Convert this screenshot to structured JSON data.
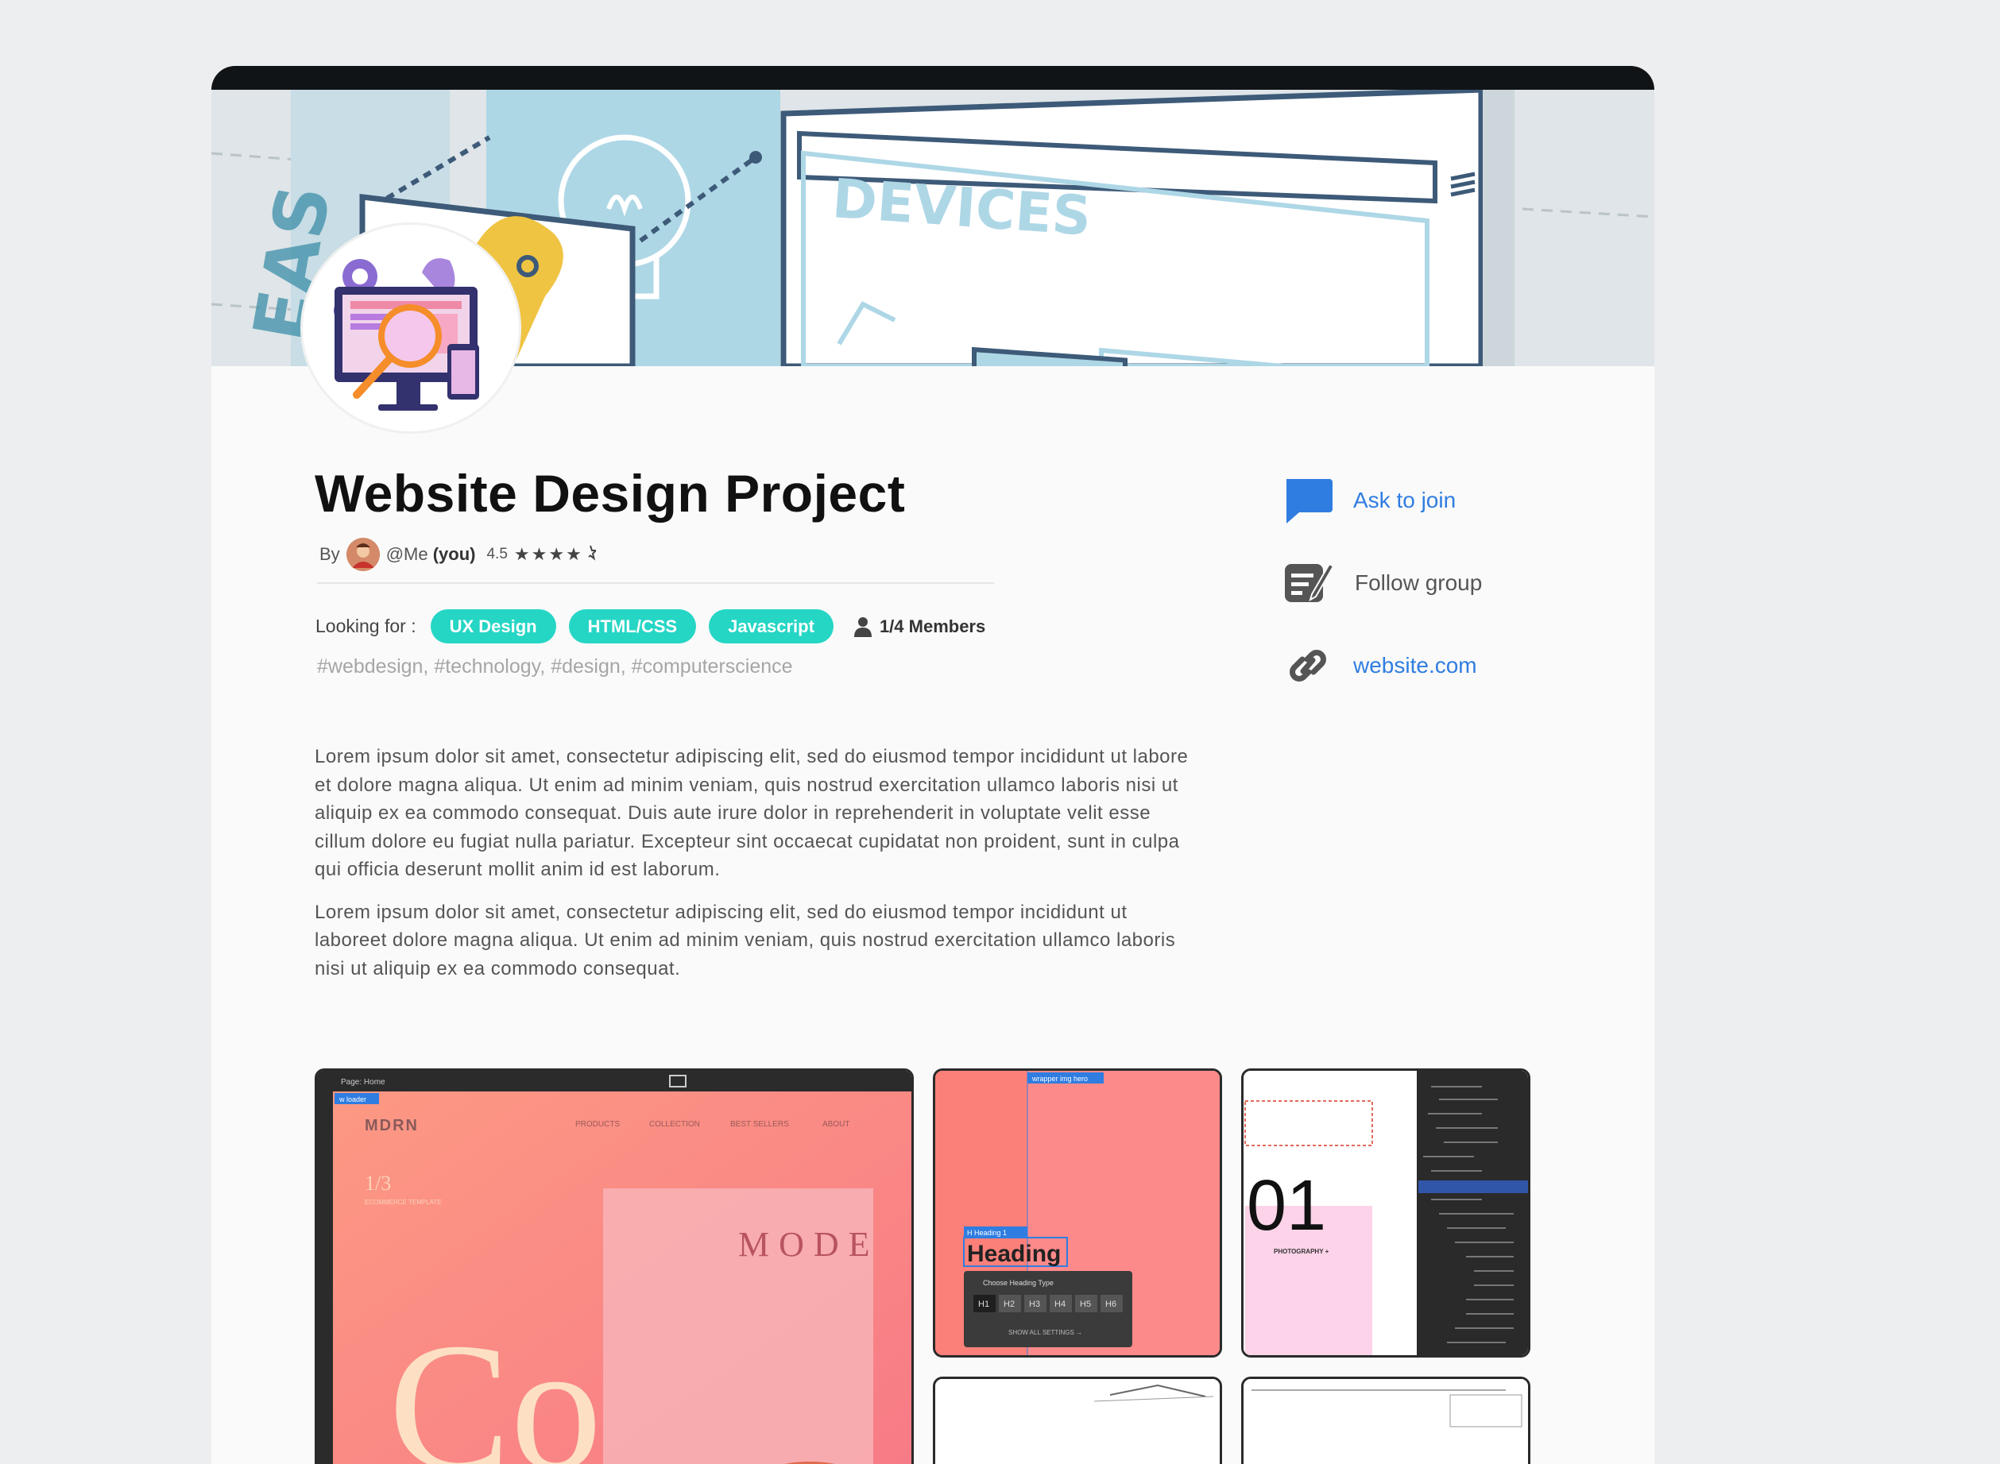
{
  "project": {
    "title": "Website Design Project",
    "by_label": "By",
    "author": "@Me",
    "author_suffix": "(you)",
    "rating": "4.5",
    "stars": "★★★★",
    "looking_for_label": "Looking for :",
    "tags": [
      "UX Design",
      "HTML/CSS",
      "Javascript"
    ],
    "members": "1/4 Members",
    "hashtags": "#webdesign, #technology, #design, #computerscience",
    "description": [
      "Lorem ipsum dolor sit amet, consectetur adipiscing elit, sed do eiusmod tempor incididunt ut labore et dolore magna aliqua. Ut enim ad minim veniam, quis nostrud exercitation ullamco laboris nisi ut aliquip ex ea commodo consequat. Duis aute irure dolor in reprehenderit in voluptate velit esse cillum dolore eu fugiat nulla pariatur. Excepteur sint occaecat cupidatat non proident, sunt in culpa qui officia deserunt mollit anim id est laborum.",
      "Lorem ipsum dolor sit amet, consectetur adipiscing elit, sed do eiusmod tempor incididunt ut laboreet dolore magna aliqua. Ut enim ad minim veniam, quis nostrud exercitation ullamco laboris nisi ut aliquip ex ea commodo consequat."
    ]
  },
  "banner": {
    "devices_text": "DEVICES",
    "ideas_text": "EAS"
  },
  "actions": {
    "ask_to_join": "Ask to join",
    "follow_group": "Follow group",
    "website": "website.com"
  },
  "gallery": {
    "main": {
      "page_label": "Page: Home",
      "loader_label": "w loader",
      "brand": "MDRN",
      "nav": [
        "PRODUCTS",
        "COLLECTION",
        "BEST SELLERS",
        "ABOUT"
      ],
      "counter": "1/3",
      "sub": "ECOMMERCE TEMPLATE",
      "big_text": "Co",
      "mode_text": "MODE"
    },
    "heading_shot": {
      "wrapper_label": "wrapper img hero",
      "heading_tag": "H Heading 1",
      "heading": "Heading",
      "choose_label": "Choose Heading Type",
      "levels": [
        "H1",
        "H2",
        "H3",
        "H4",
        "H5",
        "H6"
      ],
      "show_all": "SHOW ALL SETTINGS →"
    },
    "photo_shot": {
      "number": "01",
      "caption": "PHOTOGRAPHY +"
    }
  },
  "colors": {
    "accent_blue": "#2f7de1",
    "tag_teal": "#25d6c5",
    "banner_blue": "#aed7e6",
    "coral": "#fb8079"
  },
  "icons": {
    "ask_to_join": "chat-bubble-icon",
    "follow_group": "note-edit-icon",
    "website": "link-icon",
    "members": "person-icon"
  }
}
